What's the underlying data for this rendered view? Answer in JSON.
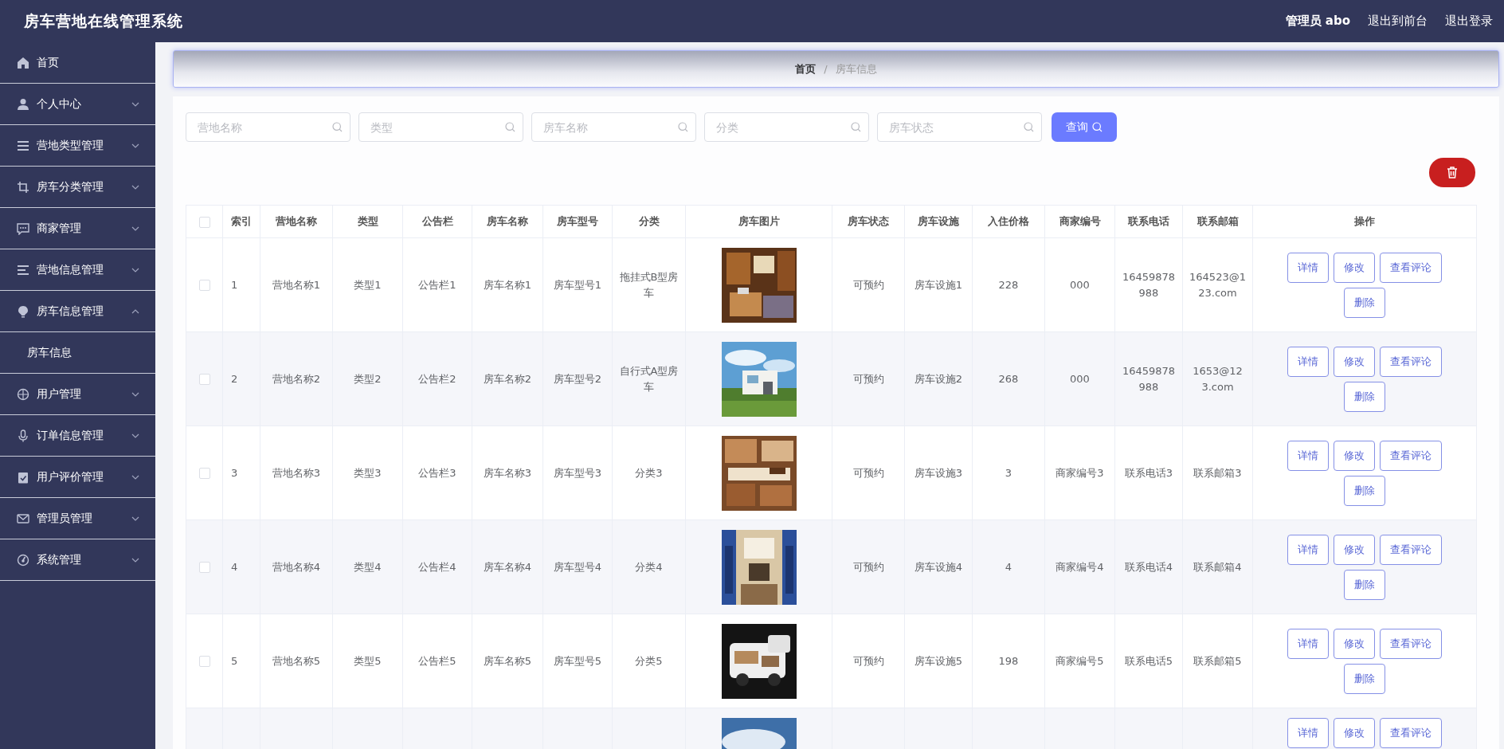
{
  "header": {
    "title": "房车营地在线管理系统",
    "user": "管理员 abo",
    "links": [
      "退出到前台",
      "退出登录"
    ]
  },
  "sidebar": {
    "items": [
      {
        "label": "首页",
        "kind": "link"
      },
      {
        "label": "个人中心",
        "kind": "group",
        "expanded": false
      },
      {
        "label": "营地类型管理",
        "kind": "group",
        "expanded": false
      },
      {
        "label": "房车分类管理",
        "kind": "group",
        "expanded": false
      },
      {
        "label": "商家管理",
        "kind": "group",
        "expanded": false
      },
      {
        "label": "营地信息管理",
        "kind": "group",
        "expanded": false
      },
      {
        "label": "房车信息管理",
        "kind": "group",
        "expanded": true,
        "children": [
          {
            "label": "房车信息"
          }
        ]
      },
      {
        "label": "用户管理",
        "kind": "group",
        "expanded": false
      },
      {
        "label": "订单信息管理",
        "kind": "group",
        "expanded": false
      },
      {
        "label": "用户评价管理",
        "kind": "group",
        "expanded": false
      },
      {
        "label": "管理员管理",
        "kind": "group",
        "expanded": false
      },
      {
        "label": "系统管理",
        "kind": "group",
        "expanded": false
      }
    ]
  },
  "breadcrumb": {
    "items": [
      "首页",
      "房车信息"
    ],
    "separator": "/"
  },
  "search": {
    "fields": [
      {
        "placeholder": "营地名称"
      },
      {
        "placeholder": "类型"
      },
      {
        "placeholder": "房车名称"
      },
      {
        "placeholder": "分类"
      },
      {
        "placeholder": "房车状态"
      }
    ],
    "button": "查询"
  },
  "table": {
    "columns": [
      "索引",
      "营地名称",
      "类型",
      "公告栏",
      "房车名称",
      "房车型号",
      "分类",
      "房车图片",
      "房车状态",
      "房车设施",
      "入住价格",
      "商家编号",
      "联系电话",
      "联系邮箱",
      "操作"
    ],
    "select_all": false,
    "rows": [
      {
        "checked": false,
        "cells": [
          "1",
          "营地名称1",
          "类型1",
          "公告栏1",
          "房车名称1",
          "房车型号1",
          "拖挂式B型房车"
        ],
        "image": {
          "kind": "picture"
        },
        "cells_after": [
          "可预约",
          "房车设施1",
          "228",
          "000",
          "16459878988",
          "164523@123.com"
        ],
        "actions": [
          "详情",
          "修改",
          "查看评论",
          "删除"
        ]
      },
      {
        "checked": false,
        "cells": [
          "2",
          "营地名称2",
          "类型2",
          "公告栏2",
          "房车名称2",
          "房车型号2",
          "自行式A型房车"
        ],
        "image": {
          "kind": "picture"
        },
        "cells_after": [
          "可预约",
          "房车设施2",
          "268",
          "000",
          "16459878988",
          "1653@123.com"
        ],
        "actions": [
          "详情",
          "修改",
          "查看评论",
          "删除"
        ]
      },
      {
        "checked": false,
        "cells": [
          "3",
          "营地名称3",
          "类型3",
          "公告栏3",
          "房车名称3",
          "房车型号3",
          "分类3"
        ],
        "image": {
          "kind": "picture"
        },
        "cells_after": [
          "可预约",
          "房车设施3",
          "3",
          "商家编号3",
          "联系电话3",
          "联系邮箱3"
        ],
        "actions": [
          "详情",
          "修改",
          "查看评论",
          "删除"
        ]
      },
      {
        "checked": false,
        "cells": [
          "4",
          "营地名称4",
          "类型4",
          "公告栏4",
          "房车名称4",
          "房车型号4",
          "分类4"
        ],
        "image": {
          "kind": "picture"
        },
        "cells_after": [
          "可预约",
          "房车设施4",
          "4",
          "商家编号4",
          "联系电话4",
          "联系邮箱4"
        ],
        "actions": [
          "详情",
          "修改",
          "查看评论",
          "删除"
        ]
      },
      {
        "checked": false,
        "cells": [
          "5",
          "营地名称5",
          "类型5",
          "公告栏5",
          "房车名称5",
          "房车型号5",
          "分类5"
        ],
        "image": {
          "kind": "picture"
        },
        "cells_after": [
          "可预约",
          "房车设施5",
          "198",
          "商家编号5",
          "联系电话5",
          "联系邮箱5"
        ],
        "actions": [
          "详情",
          "修改",
          "查看评论",
          "删除"
        ]
      },
      {
        "image": {
          "kind": "picture"
        },
        "actions": [
          "详情",
          "修改",
          "查看评论"
        ]
      }
    ]
  }
}
